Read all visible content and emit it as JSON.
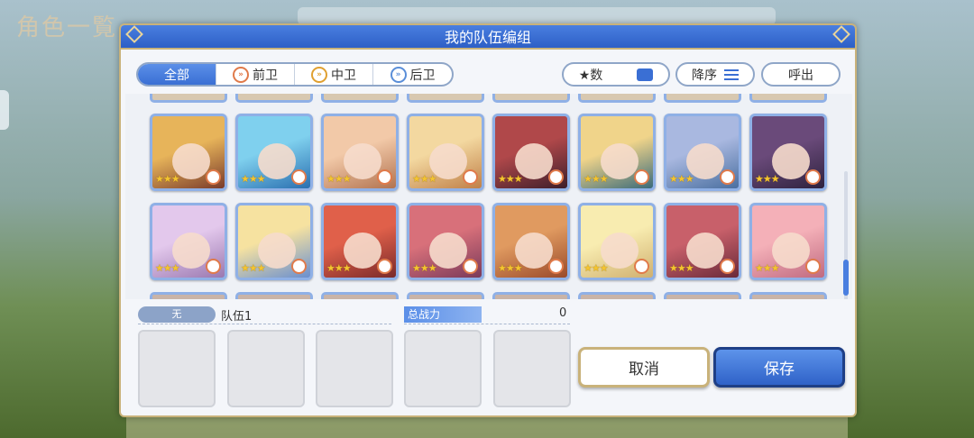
{
  "background": {
    "title": "角色一覧"
  },
  "dialog": {
    "title": "我的队伍编组"
  },
  "filters": {
    "tabs": [
      {
        "label": "全部",
        "icon": null
      },
      {
        "label": "前卫",
        "icon": "front-position-icon"
      },
      {
        "label": "中卫",
        "icon": "middle-position-icon"
      },
      {
        "label": "后卫",
        "icon": "back-position-icon"
      }
    ],
    "active": "全部"
  },
  "sort": {
    "key_label": "★数",
    "order_label": "降序",
    "recall_label": "呼出"
  },
  "characters": [
    {
      "stars": 3,
      "colors": [
        "#e7b45a",
        "#7a3b2a"
      ]
    },
    {
      "stars": 3,
      "colors": [
        "#7fd0ee",
        "#2a6fb0"
      ]
    },
    {
      "stars": 3,
      "colors": [
        "#f2c9a8",
        "#b27350"
      ]
    },
    {
      "stars": 3,
      "colors": [
        "#f3d8a0",
        "#c08048"
      ]
    },
    {
      "stars": 3,
      "colors": [
        "#b0484a",
        "#3d1e2a"
      ]
    },
    {
      "stars": 3,
      "colors": [
        "#f0d48a",
        "#3a6a7a"
      ]
    },
    {
      "stars": 3,
      "colors": [
        "#a9b8e0",
        "#4a6fa0"
      ]
    },
    {
      "stars": 3,
      "colors": [
        "#6a4a7a",
        "#2e223e"
      ]
    },
    {
      "stars": 3,
      "colors": [
        "#e3c8ec",
        "#9a78b0"
      ]
    },
    {
      "stars": 3,
      "colors": [
        "#f6e2a0",
        "#6a8fd0"
      ]
    },
    {
      "stars": 3,
      "colors": [
        "#e0604a",
        "#7a2a2a"
      ]
    },
    {
      "stars": 3,
      "colors": [
        "#d8707a",
        "#7a3a5a"
      ]
    },
    {
      "stars": 3,
      "colors": [
        "#e09a60",
        "#9a4a2a"
      ]
    },
    {
      "stars": 3,
      "colors": [
        "#f8ecb0",
        "#d0b070"
      ]
    },
    {
      "stars": 3,
      "colors": [
        "#c8606a",
        "#6a2a3a"
      ]
    },
    {
      "stars": 3,
      "colors": [
        "#f4b0b8",
        "#c06a80"
      ]
    }
  ],
  "team": {
    "clan_label": "无",
    "name": "队伍1",
    "power_label": "总战力",
    "power_value": "0"
  },
  "buttons": {
    "cancel": "取消",
    "save": "保存"
  }
}
